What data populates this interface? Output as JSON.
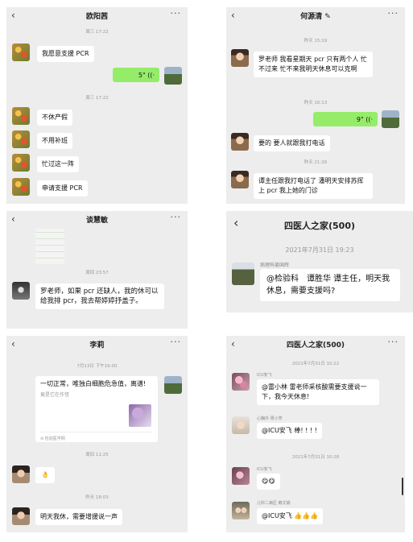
{
  "p1": {
    "title": "欧阳茜",
    "time1": "周三 17:22",
    "msg1": "我愿意支援 PCR",
    "voice": "5\" ((·",
    "time2": "周三 17:22",
    "msg2": "不休产假",
    "msg3": "不用补班",
    "msg4": "忙过这一阵",
    "msg5": "申请支援 PCR"
  },
  "p2": {
    "title": "何源清 ✎",
    "time1": "昨天 15:19",
    "msg1": "罗老师 我看星期天 pcr 只有两个人 忙不过来 忙不来我明天休息可以克啊",
    "time2": "昨天 16:13",
    "voice": "9\" ((·",
    "msg2": "要的 要人就跟我打电话",
    "time3": "昨天 21:26",
    "msg3": "谭主任跟我打电话了 潘明天安排苏挥上 pcr 我上她的门诊"
  },
  "p3": {
    "title": "谈慧敏",
    "time1": "周四 23:57",
    "msg1": "罗老师，如果 pcr 还缺人，我的休可以给我排 pcr，我去帮婷婷抒盖子。"
  },
  "p4": {
    "title": "四医人之家(500)",
    "time1": "2021年7月31日 19:23",
    "sender": "病理科姜国辉",
    "msg1": "@检验科　谭胜华 谭主任，明天我休息，需要支援吗?"
  },
  "p5": {
    "title": "李莉",
    "time1": "7月13日 下午16:00",
    "card_text": "一切正常，唯独白细胞危急值，离谱!",
    "card_sub": "竟是它在作怪",
    "card_source": "检验医学网",
    "time2": "周四 11:25",
    "emoji": "👌",
    "time3": "昨天 18:03",
    "msg1": "明天我休，需要增援说一声"
  },
  "p6": {
    "title": "四医人之家(500)",
    "time1": "2021年7月31日 10:22",
    "sender1": "ICU安飞",
    "msg1": "@雷小林 雷老师采核酸需要支援说一下，我今天休息!",
    "sender2": "心胸外 周小芳",
    "msg2": "@ICU安飞 棒! ! ! !",
    "time2": "2021年7月31日 10:28",
    "sender3": "ICU安飞",
    "emoji3": "😋😋",
    "sender4": "儿科二病区 赖文娟",
    "msg4": "@ICU安飞 👍👍👍"
  }
}
